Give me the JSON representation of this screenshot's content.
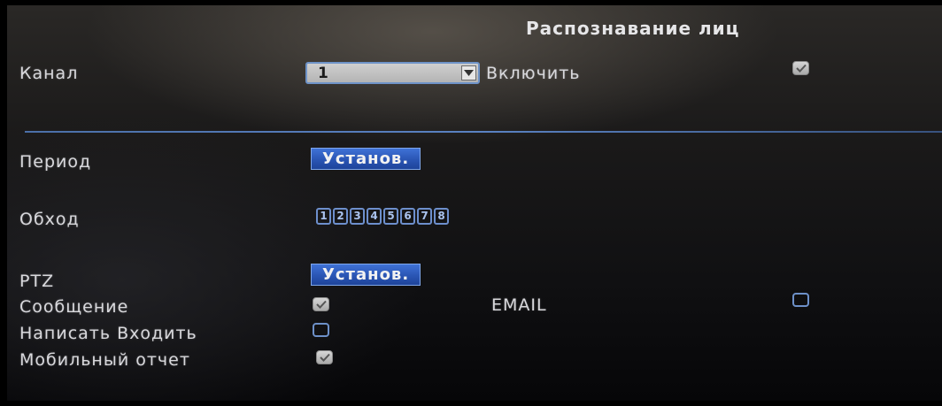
{
  "window": {
    "title": "Распознавание лиц"
  },
  "channel": {
    "label": "Канал",
    "value": "1",
    "enable_label": "Включить",
    "enable_checked": true
  },
  "period": {
    "label": "Период",
    "button_label": "Установ."
  },
  "tour": {
    "label": "Обход",
    "items": [
      "1",
      "2",
      "3",
      "4",
      "5",
      "6",
      "7",
      "8"
    ]
  },
  "ptz": {
    "label": "PTZ",
    "button_label": "Установ."
  },
  "message": {
    "label": "Сообщение",
    "checked": true
  },
  "email": {
    "label": "EMAIL",
    "checked": false
  },
  "write_input": {
    "label": "Написать Входить",
    "checked": false
  },
  "mobile_report": {
    "label": "Мобильный отчет",
    "checked": true
  },
  "colors": {
    "accent": "#3f72d6",
    "border": "#6d90c8",
    "text": "#d8d8dc"
  }
}
